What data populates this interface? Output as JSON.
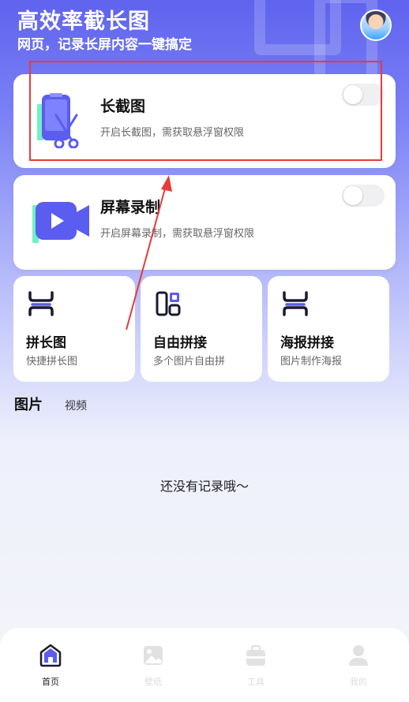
{
  "header": {
    "title": "高效率截长图",
    "subtitle": "网页，记录长屏内容一键搞定"
  },
  "cards": [
    {
      "title": "长截图",
      "desc": "开启长截图，需获取悬浮窗权限",
      "enabled": false,
      "icon": "scissors-phone-icon"
    },
    {
      "title": "屏幕录制",
      "desc": "开启屏幕录制，需获取悬浮窗权限",
      "enabled": false,
      "icon": "video-camera-icon"
    }
  ],
  "tools": [
    {
      "title": "拼长图",
      "sub": "快捷拼长图",
      "icon": "stitch-icon"
    },
    {
      "title": "自由拼接",
      "sub": "多个图片自由拼",
      "icon": "grid-icon"
    },
    {
      "title": "海报拼接",
      "sub": "图片制作海报",
      "icon": "poster-stitch-icon"
    }
  ],
  "tabs": {
    "active": "图片",
    "other": "视频"
  },
  "empty_text": "还没有记录哦～",
  "nav": [
    {
      "label": "首页",
      "icon": "home-icon",
      "active": true
    },
    {
      "label": "壁纸",
      "icon": "picture-icon",
      "active": false
    },
    {
      "label": "工具",
      "icon": "toolbox-icon",
      "active": false
    },
    {
      "label": "我的",
      "icon": "user-icon",
      "active": false
    }
  ],
  "colors": {
    "accent": "#5b5cf0",
    "annotation": "#e53c3c"
  }
}
